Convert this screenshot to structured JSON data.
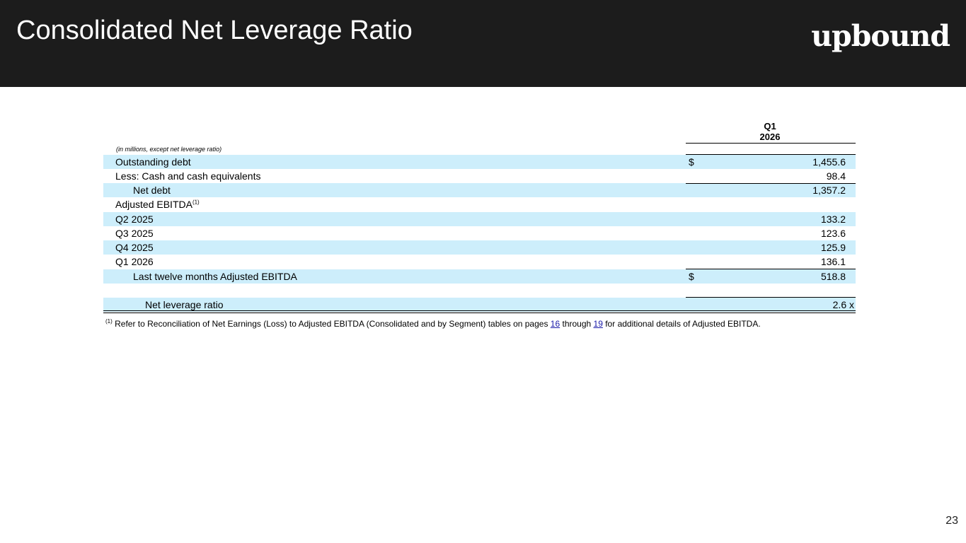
{
  "header": {
    "title": "Consolidated Net Leverage Ratio",
    "logo_text": "upbound"
  },
  "table": {
    "column_header_line1": "Q1",
    "column_header_line2": "2026",
    "units_note": "(in millions, except net leverage ratio)",
    "rows": [
      {
        "label": "Outstanding debt",
        "currency": "$",
        "value": "1,455.6"
      },
      {
        "label": "Less: Cash and cash equivalents",
        "currency": "",
        "value": "98.4"
      },
      {
        "label": "Net debt",
        "currency": "",
        "value": "1,357.2"
      },
      {
        "label": "Adjusted EBITDA",
        "label_sup": "(1)",
        "currency": "",
        "value": ""
      },
      {
        "label": "Q2 2025",
        "currency": "",
        "value": "133.2"
      },
      {
        "label": "Q3 2025",
        "currency": "",
        "value": "123.6"
      },
      {
        "label": "Q4 2025",
        "currency": "",
        "value": "125.9"
      },
      {
        "label": "Q1 2026",
        "currency": "",
        "value": "136.1"
      },
      {
        "label": "Last twelve months Adjusted EBITDA",
        "currency": "$",
        "value": "518.8"
      },
      {
        "label": "Net leverage ratio",
        "currency": "",
        "value": "2.6 x"
      }
    ]
  },
  "footnote": {
    "marker": "(1)",
    "text_before": " Refer to Reconciliation of Net Earnings (Loss) to Adjusted EBITDA (Consolidated and by Segment) tables on pages ",
    "link1": "16",
    "text_middle": " through ",
    "link2": "19",
    "text_after": " for additional details of Adjusted EBITDA."
  },
  "page_number": "23"
}
